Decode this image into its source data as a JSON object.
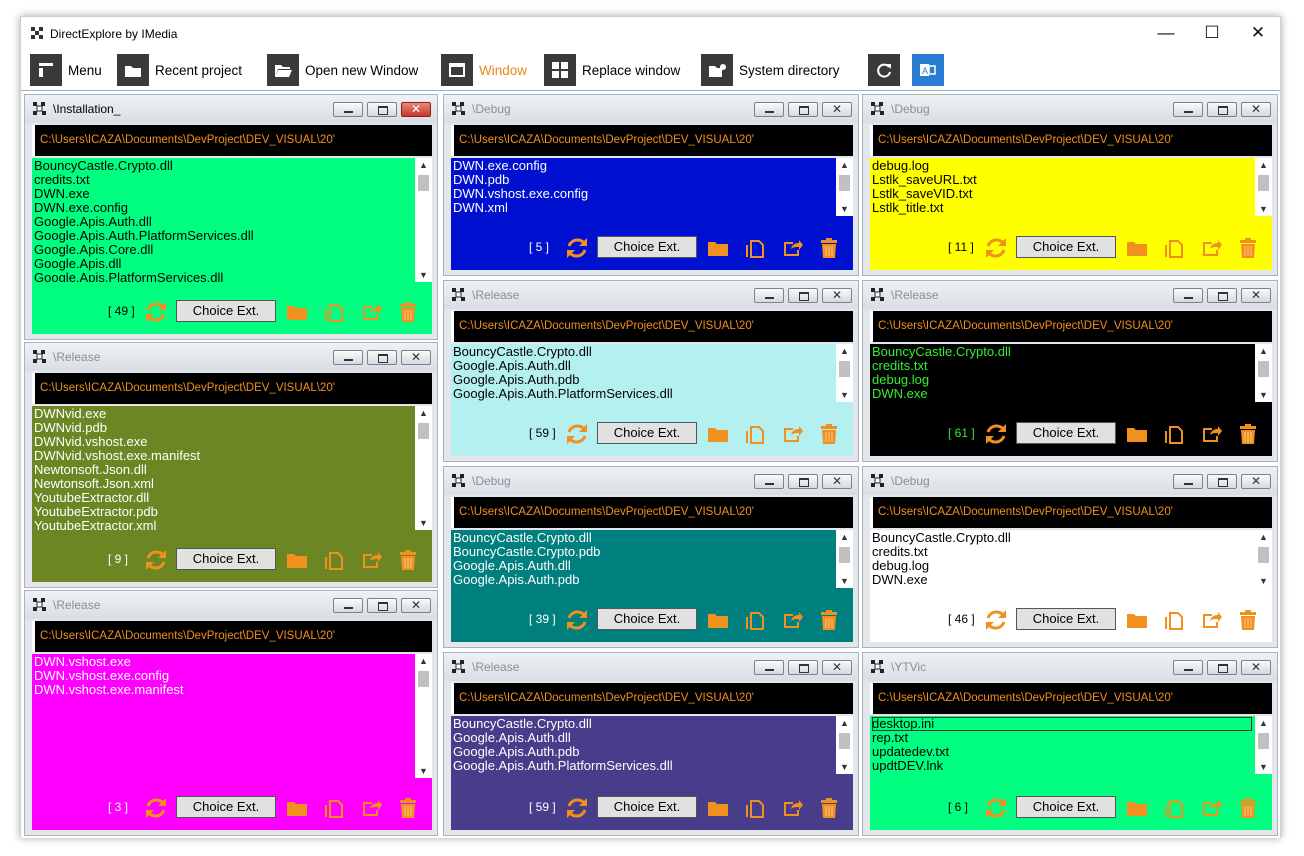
{
  "window": {
    "title": "DirectExplore by IMedia",
    "controls": {
      "minimize": "—",
      "maximize": "☐",
      "close": "✕"
    }
  },
  "toolbar": [
    {
      "label": "Menu",
      "icon": "menu-icon",
      "accent": "#000000"
    },
    {
      "label": "Recent project",
      "icon": "folder-icon",
      "accent": "#000000"
    },
    {
      "label": "Open new Window",
      "icon": "folder-open-icon",
      "accent": "#000000"
    },
    {
      "label": "Window",
      "icon": "window-icon",
      "accent": "#e8891a"
    },
    {
      "label": "Replace window",
      "icon": "grid-icon",
      "accent": "#000000"
    },
    {
      "label": "System directory",
      "icon": "system-folder-icon",
      "accent": "#000000"
    },
    {
      "label": "",
      "icon": "sync-icon",
      "accent": "#000000"
    },
    {
      "label": "",
      "icon": "office-icon",
      "accent": "#000000"
    }
  ],
  "choice_label": "Choice Ext.",
  "accent_orange": "#f0901e",
  "panels": [
    {
      "title": "\\Installation_",
      "path": "C:\\Users\\ICAZA\\Documents\\DevProject\\DEV_VISUAL\\20'",
      "count": "[ 49 ]",
      "bg": "#00ff80",
      "fg": "#000000",
      "pathcolor": "#f0901e",
      "active": true,
      "files": [
        "BouncyCastle.Crypto.dll",
        "credits.txt",
        "DWN.exe",
        "DWN.exe.config",
        "Google.Apis.Auth.dll",
        "Google.Apis.Auth.PlatformServices.dll",
        "Google.Apis.Core.dll",
        "Google.Apis.dll",
        "Google.Apis.PlatformServices.dll"
      ]
    },
    {
      "title": "\\Release",
      "path": "C:\\Users\\ICAZA\\Documents\\DevProject\\DEV_VISUAL\\20'",
      "count": "[ 9 ]",
      "bg": "#6b8623",
      "fg": "#ffffff",
      "pathcolor": "#f0901e",
      "files": [
        "DWNvid.exe",
        "DWNvid.pdb",
        "DWNvid.vshost.exe",
        "DWNvid.vshost.exe.manifest",
        "Newtonsoft.Json.dll",
        "Newtonsoft.Json.xml",
        "YoutubeExtractor.dll",
        "YoutubeExtractor.pdb",
        "YoutubeExtractor.xml"
      ]
    },
    {
      "title": "\\Release",
      "path": "C:\\Users\\ICAZA\\Documents\\DevProject\\DEV_VISUAL\\20'",
      "count": "[ 3 ]",
      "bg": "#ff00ff",
      "fg": "#ffffff",
      "pathcolor": "#f0901e",
      "files": [
        "DWN.vshost.exe",
        "DWN.vshost.exe.config",
        "DWN.vshost.exe.manifest"
      ]
    },
    {
      "title": "\\Debug",
      "path": "C:\\Users\\ICAZA\\Documents\\DevProject\\DEV_VISUAL\\20'",
      "count": "[ 5 ]",
      "bg": "#0010d0",
      "fg": "#ffffff",
      "pathcolor": "#f0901e",
      "files": [
        "DWN.exe.config",
        "DWN.pdb",
        "DWN.vshost.exe.config",
        "DWN.xml"
      ]
    },
    {
      "title": "\\Release",
      "path": "C:\\Users\\ICAZA\\Documents\\DevProject\\DEV_VISUAL\\20'",
      "count": "[ 59 ]",
      "bg": "#b4f0f0",
      "fg": "#000000",
      "pathcolor": "#f0901e",
      "files": [
        "BouncyCastle.Crypto.dll",
        "Google.Apis.Auth.dll",
        "Google.Apis.Auth.pdb",
        "Google.Apis.Auth.PlatformServices.dll"
      ]
    },
    {
      "title": "\\Debug",
      "path": "C:\\Users\\ICAZA\\Documents\\DevProject\\DEV_VISUAL\\20'",
      "count": "[ 39 ]",
      "bg": "#007f7f",
      "fg": "#ffffff",
      "pathcolor": "#f0901e",
      "files": [
        "BouncyCastle.Crypto.dll",
        "BouncyCastle.Crypto.pdb",
        "Google.Apis.Auth.dll",
        "Google.Apis.Auth.pdb"
      ]
    },
    {
      "title": "\\Release",
      "path": "C:\\Users\\ICAZA\\Documents\\DevProject\\DEV_VISUAL\\20'",
      "count": "[ 59 ]",
      "bg": "#483d8b",
      "fg": "#ffffff",
      "pathcolor": "#f0901e",
      "files": [
        "BouncyCastle.Crypto.dll",
        "Google.Apis.Auth.dll",
        "Google.Apis.Auth.pdb",
        "Google.Apis.Auth.PlatformServices.dll"
      ]
    },
    {
      "title": "\\Debug",
      "path": "C:\\Users\\ICAZA\\Documents\\DevProject\\DEV_VISUAL\\20'",
      "count": "[ 11 ]",
      "bg": "#ffff00",
      "fg": "#000000",
      "pathcolor": "#f0901e",
      "files": [
        "debug.log",
        "Lstlk_saveURL.txt",
        "Lstlk_saveVID.txt",
        "Lstlk_title.txt"
      ]
    },
    {
      "title": "\\Release",
      "path": "C:\\Users\\ICAZA\\Documents\\DevProject\\DEV_VISUAL\\20'",
      "count": "[ 61 ]",
      "bg": "#000000",
      "fg": "#33ee33",
      "pathcolor": "#f0901e",
      "files": [
        "BouncyCastle.Crypto.dll",
        "credits.txt",
        "debug.log",
        "DWN.exe"
      ]
    },
    {
      "title": "\\Debug",
      "path": "C:\\Users\\ICAZA\\Documents\\DevProject\\DEV_VISUAL\\20'",
      "count": "[ 46 ]",
      "bg": "#ffffff",
      "fg": "#000000",
      "pathcolor": "#f0901e",
      "files": [
        "BouncyCastle.Crypto.dll",
        "credits.txt",
        "debug.log",
        "DWN.exe"
      ]
    },
    {
      "title": "\\YTVic",
      "path": "C:\\Users\\ICAZA\\Documents\\DevProject\\DEV_VISUAL\\20'",
      "count": "[ 6 ]",
      "bg": "#00ff80",
      "fg": "#000000",
      "pathcolor": "#f0901e",
      "files": [
        "desktop.ini",
        "rep.txt",
        "updatedev.txt",
        "updtDEV.lnk"
      ],
      "selected": 0
    }
  ]
}
